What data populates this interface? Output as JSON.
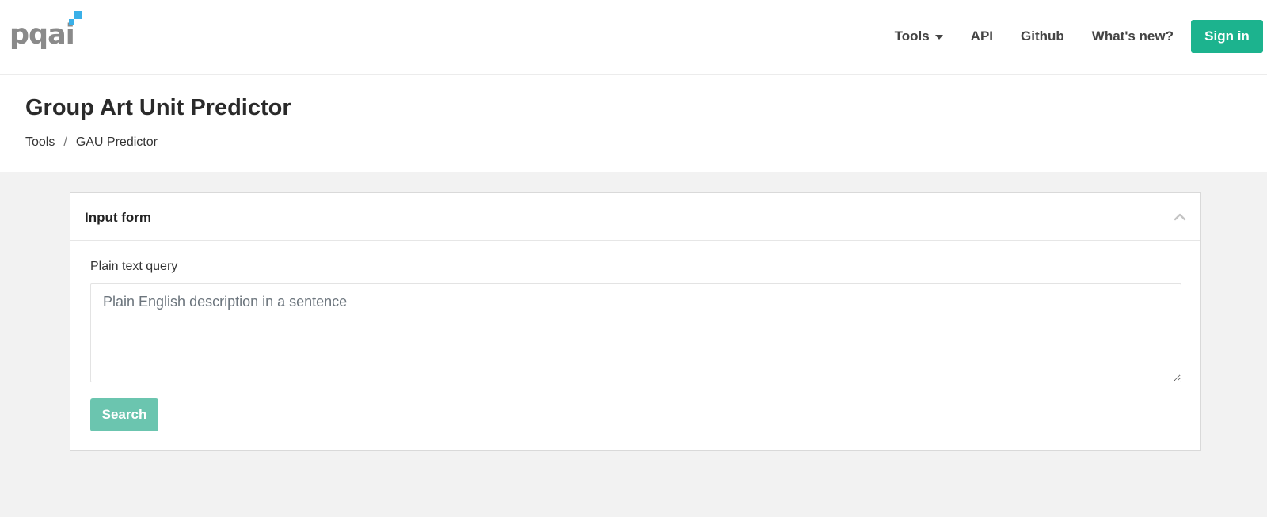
{
  "brand": {
    "logo_text": "pqai",
    "accent_color": "#1cb38e",
    "logo_mark_color": "#3ab0e8"
  },
  "nav": {
    "items": [
      {
        "label": "Tools",
        "has_dropdown": true
      },
      {
        "label": "API"
      },
      {
        "label": "Github"
      },
      {
        "label": "What's new?"
      }
    ],
    "signin_label": "Sign in"
  },
  "page": {
    "title": "Group Art Unit Predictor",
    "breadcrumb": [
      "Tools",
      "GAU Predictor"
    ],
    "breadcrumb_separator": "/"
  },
  "form": {
    "title": "Input form",
    "collapse_icon": "chevron-up-icon",
    "query_label": "Plain text query",
    "query_value": "",
    "query_placeholder": "Plain English description in a sentence",
    "search_label": "Search",
    "search_disabled": true
  }
}
